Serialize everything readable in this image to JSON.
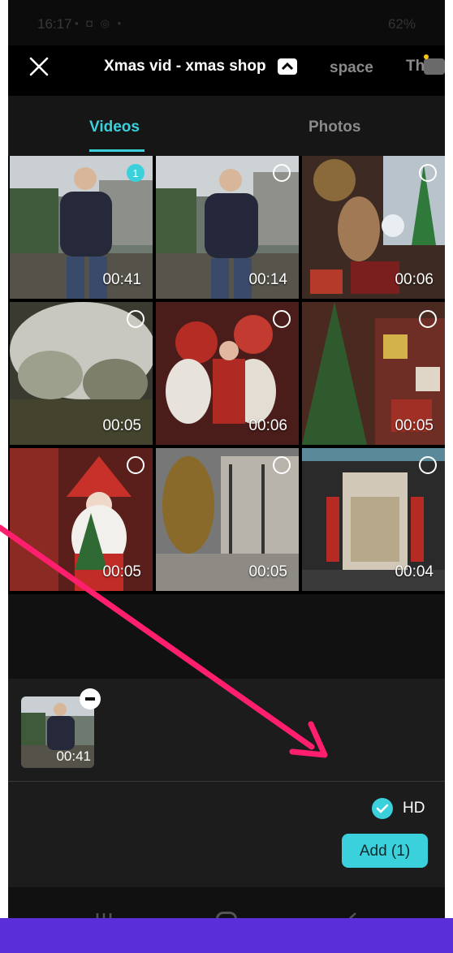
{
  "status_bar": {
    "time": "16:17",
    "battery": "62%"
  },
  "header": {
    "album_title": "Xmas vid - xmas shop",
    "other_albums": [
      "space",
      "Th"
    ]
  },
  "media_tabs": {
    "videos": "Videos",
    "photos": "Photos",
    "active": "Videos"
  },
  "grid": {
    "items": [
      {
        "duration": "00:41",
        "selected": true,
        "selection_number": "1"
      },
      {
        "duration": "00:14",
        "selected": false
      },
      {
        "duration": "00:06",
        "selected": false
      },
      {
        "duration": "00:05",
        "selected": false
      },
      {
        "duration": "00:06",
        "selected": false
      },
      {
        "duration": "00:05",
        "selected": false
      },
      {
        "duration": "00:05",
        "selected": false
      },
      {
        "duration": "00:05",
        "selected": false
      },
      {
        "duration": "00:04",
        "selected": false
      }
    ]
  },
  "tray": {
    "items": [
      {
        "duration": "00:41"
      }
    ]
  },
  "bottom": {
    "hd_label": "HD",
    "hd_checked": true,
    "add_label": "Add (1)"
  },
  "colors": {
    "accent": "#3ad1dc",
    "annotation_arrow": "#ff1f6e",
    "frame": "#5b2fd8"
  }
}
